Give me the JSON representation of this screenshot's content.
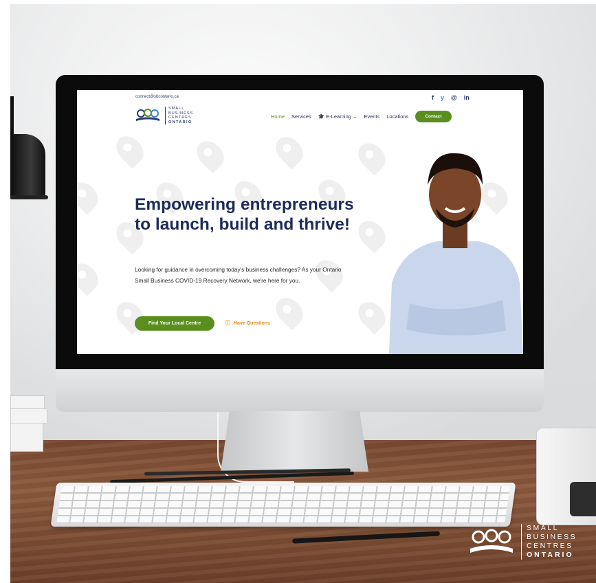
{
  "topbar": {
    "email": "connect@sbcontario.ca",
    "social": [
      "f",
      "y",
      "@",
      "in"
    ]
  },
  "logo": {
    "line1": "SMALL",
    "line2": "BUSINESS",
    "line3": "CENTRES",
    "line4": "ONTARIO"
  },
  "nav": {
    "items": [
      {
        "label": "Home",
        "active": true
      },
      {
        "label": "Services",
        "active": false
      },
      {
        "label": "E-Learning",
        "active": false
      },
      {
        "label": "Events",
        "active": false
      },
      {
        "label": "Locations",
        "active": false
      }
    ],
    "contact_label": "Contact"
  },
  "hero": {
    "title": "Empowering entrepreneurs to launch, build and thrive!",
    "subtitle": "Looking for guidance in overcoming today's business challenges? As your Ontario Small Business COVID-19 Recovery Network, we're here for you.",
    "primary_cta": "Find Your Local Centre",
    "secondary_cta": "Have Questions"
  },
  "watermark": {
    "line1": "SMALL",
    "line2": "BUSINESS",
    "line3": "CENTRES",
    "line4": "ONTARIO"
  },
  "colors": {
    "brand_navy": "#1d2b5a",
    "brand_green": "#5a8e1e",
    "accent_orange": "#e38a18"
  },
  "icons": {
    "facebook": "facebook-icon",
    "twitter": "twitter-icon",
    "instagram": "instagram-icon",
    "linkedin": "linkedin-icon",
    "elearning": "graduation-cap-icon",
    "chevron": "chevron-down-icon",
    "question": "question-circle-icon"
  }
}
